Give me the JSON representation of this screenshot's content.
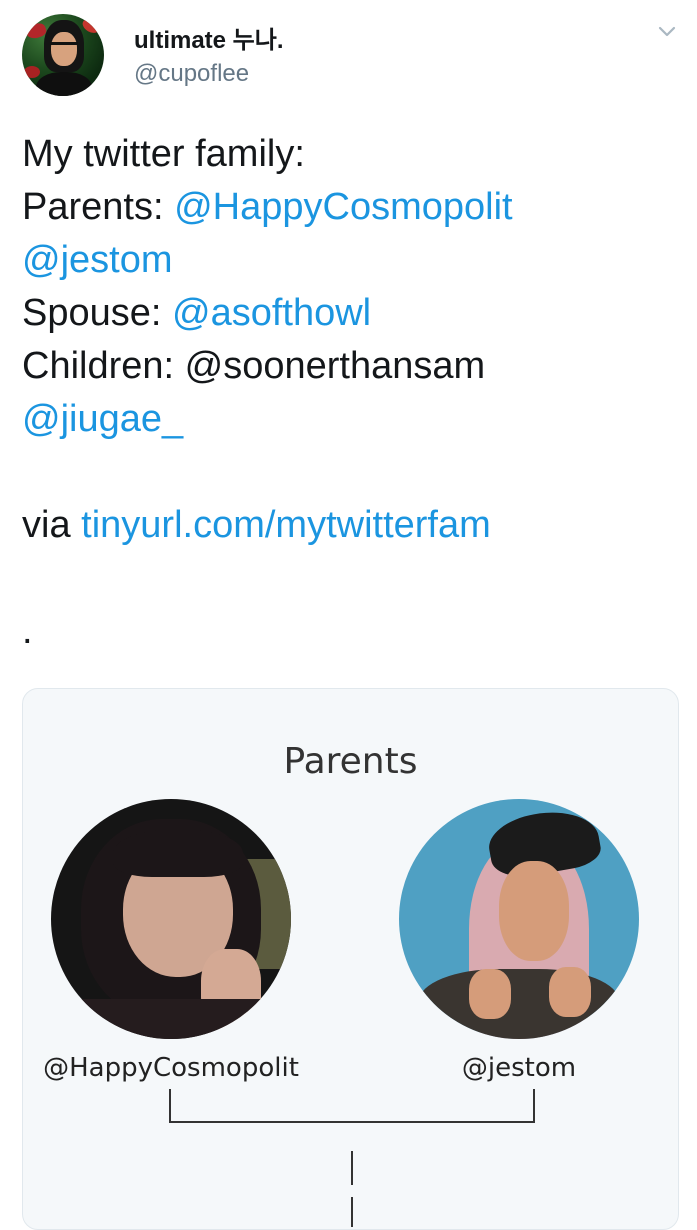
{
  "tweet": {
    "author": {
      "display_name": "ultimate 누나.",
      "handle": "@cupoflee"
    },
    "menu_icon": "chevron-down-icon",
    "lines": [
      {
        "prefix": "My twitter family:",
        "mention": ""
      },
      {
        "prefix": "Parents: ",
        "mention": "@HappyCosmopolit"
      },
      {
        "prefix": "",
        "mention": "@jestom"
      },
      {
        "prefix": "Spouse: ",
        "mention": "@asofthowl"
      },
      {
        "prefix": "Children: @soonerthansam",
        "mention": ""
      },
      {
        "prefix": "",
        "mention": "@jiugae_"
      }
    ],
    "via_prefix": "via ",
    "via_link": "tinyurl.com/mytwitterfam",
    "trailing": "."
  },
  "card": {
    "title": "Parents",
    "parents": [
      {
        "handle": "@HappyCosmopolit"
      },
      {
        "handle": "@jestom"
      }
    ]
  },
  "colors": {
    "link": "#1b95e0",
    "text": "#14171a",
    "secondary": "#657786",
    "card_bg": "#f5f8fa",
    "card_border": "#e1e8ed"
  }
}
